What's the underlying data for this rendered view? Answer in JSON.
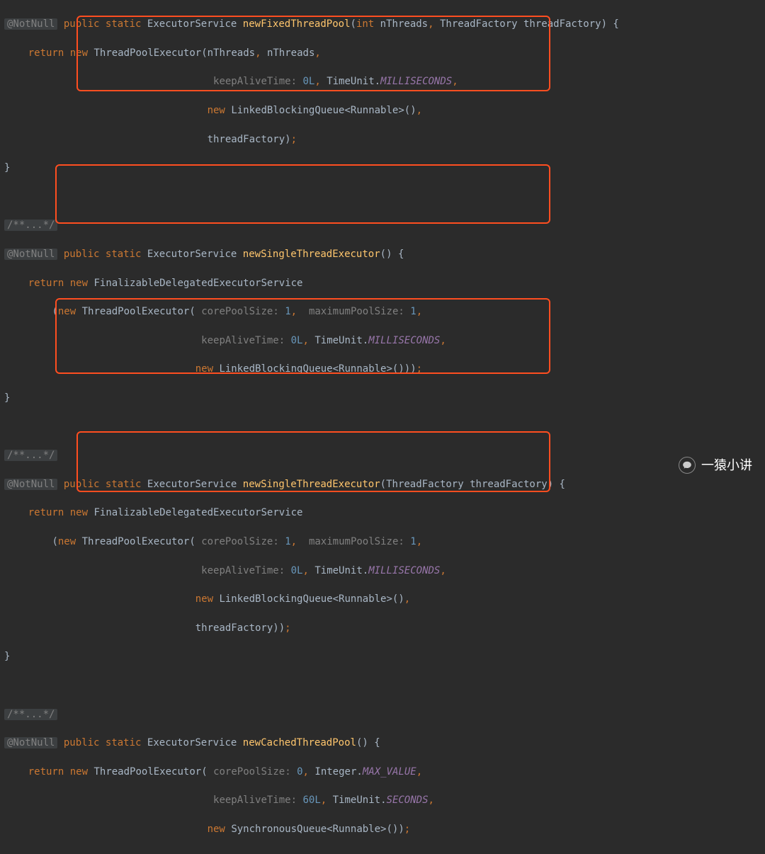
{
  "annotation": "@NotNull",
  "foldedDoc": "/**...*/",
  "keywords": {
    "public": "public",
    "static": "static",
    "return": "return",
    "new": "new",
    "int": "int"
  },
  "classes": {
    "ExecutorService": "ExecutorService",
    "ThreadPoolExecutor": "ThreadPoolExecutor",
    "ThreadFactory": "ThreadFactory",
    "TimeUnit": "TimeUnit",
    "Integer": "Integer",
    "LinkedBlockingQueue": "LinkedBlockingQueue",
    "SynchronousQueue": "SynchronousQueue",
    "Runnable": "Runnable",
    "FinalizableDelegatedExecutorService": "FinalizableDelegatedExecutorService"
  },
  "constants": {
    "MILLISECONDS": "MILLISECONDS",
    "SECONDS": "SECONDS",
    "MAX_VALUE": "MAX_VALUE"
  },
  "hints": {
    "corePoolSize": "corePoolSize:",
    "maximumPoolSize": "maximumPoolSize:",
    "keepAliveTime": "keepAliveTime:"
  },
  "numbers": {
    "zero": "0",
    "one": "1",
    "zeroL": "0L",
    "sixtyL": "60L"
  },
  "vars": {
    "nThreads": "nThreads",
    "threadFactory": "threadFactory"
  },
  "methods": {
    "newFixedThreadPool": "newFixedThreadPool",
    "newSingleThreadExecutor": "newSingleThreadExecutor",
    "newCachedThreadPool": "newCachedThreadPool"
  },
  "watermark": "一猿小讲"
}
